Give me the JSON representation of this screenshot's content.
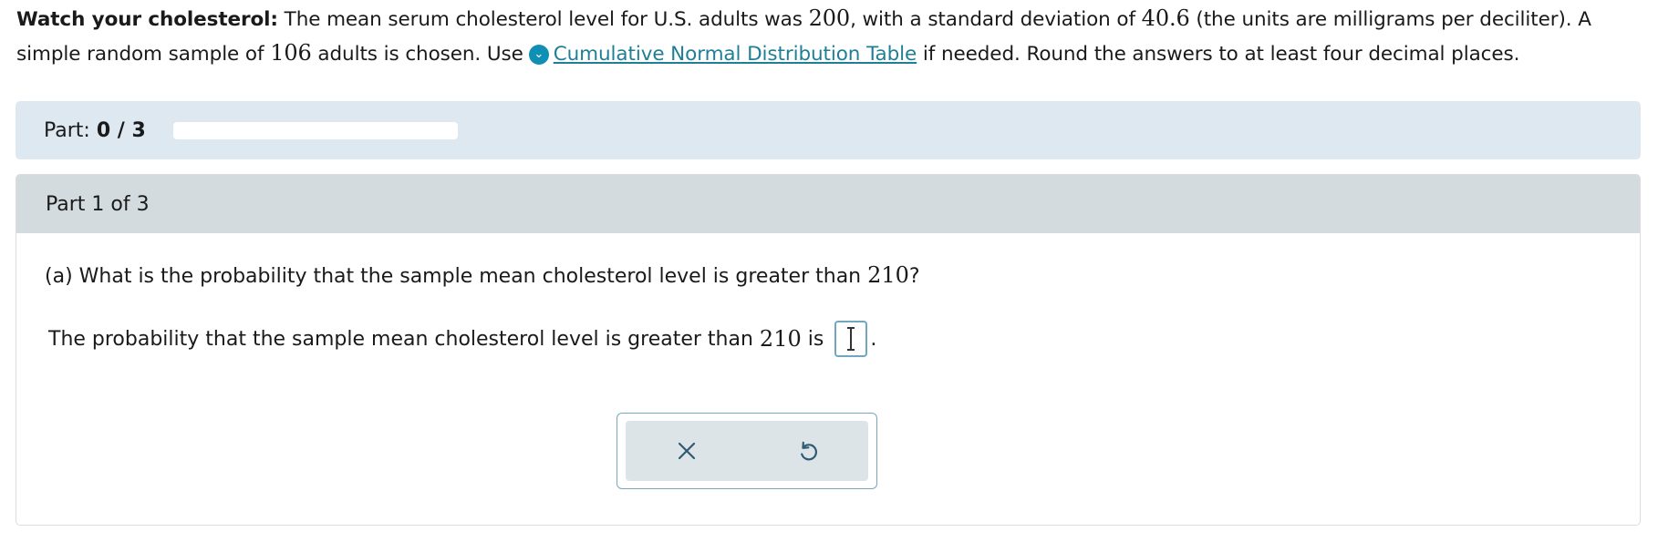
{
  "problem": {
    "title": "Watch your cholesterol:",
    "text1": " The mean serum cholesterol level for U.S. adults was ",
    "mean": "200",
    "text2": ", with a standard deviation of ",
    "sd": "40.6",
    "text3": " (the units are milligrams per deciliter). A simple random sample of ",
    "n": "106",
    "text4": " adults is chosen. Use",
    "link_text": "Cumulative Normal Distribution Table",
    "text5": " if needed. Round the answers to at least four decimal places.",
    "info_icon": "chevron-down-circle-icon"
  },
  "progress": {
    "label": "Part: ",
    "value": "0 / 3",
    "fraction": 0.0
  },
  "part": {
    "header": "Part 1 of 3",
    "question_prefix": "(a) What is the probability that the sample mean cholesterol level is greater than ",
    "question_value": "210",
    "question_suffix": "?",
    "answer_prefix": "The probability that the sample mean cholesterol level is greater than ",
    "answer_value": "210",
    "answer_mid": " is",
    "answer_suffix": ".",
    "answer_input_value": ""
  },
  "tools": {
    "clear_icon": "close-icon",
    "undo_icon": "undo-icon"
  },
  "colors": {
    "link": "#1f7f95",
    "progress_bg": "#dde8f0",
    "header_bg": "#d3dbdf",
    "input_border": "#6fa7be"
  }
}
